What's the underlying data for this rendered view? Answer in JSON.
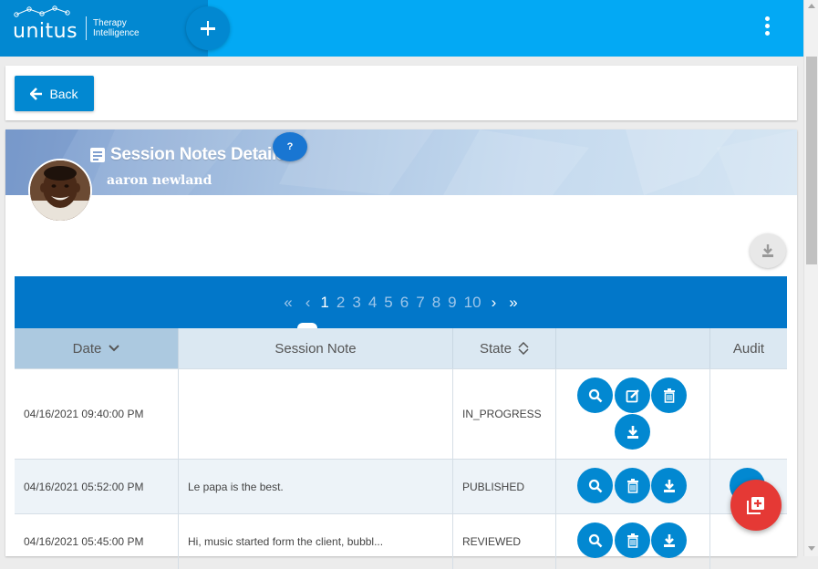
{
  "app": {
    "logo_text": "unitus",
    "logo_tagline_1": "Therapy",
    "logo_tagline_2": "Intelligence"
  },
  "toolbar": {
    "back_label": "Back"
  },
  "details": {
    "title": "Session Notes Details",
    "help_label": "?",
    "patient_name": "aaron newland"
  },
  "pagination": {
    "pages": [
      "1",
      "2",
      "3",
      "4",
      "5",
      "6",
      "7",
      "8",
      "9",
      "10"
    ],
    "current": "1"
  },
  "table": {
    "headers": {
      "date": "Date",
      "session_note": "Session Note",
      "state": "State",
      "actions": "",
      "audit": "Audit"
    },
    "rows": [
      {
        "date": "04/16/2021 09:40:00 PM",
        "note": "",
        "state": "IN_PROGRESS"
      },
      {
        "date": "04/16/2021 05:52:00 PM",
        "note": "Le papa is the best.",
        "state": "PUBLISHED"
      },
      {
        "date": "04/16/2021 05:45:00 PM",
        "note": "Hi, music started form the client, bubbl...",
        "state": "REVIEWED"
      }
    ]
  },
  "colors": {
    "primary": "#0288d1",
    "topbar": "#03a9f4",
    "pager": "#0277c9",
    "fab": "#e53935"
  }
}
